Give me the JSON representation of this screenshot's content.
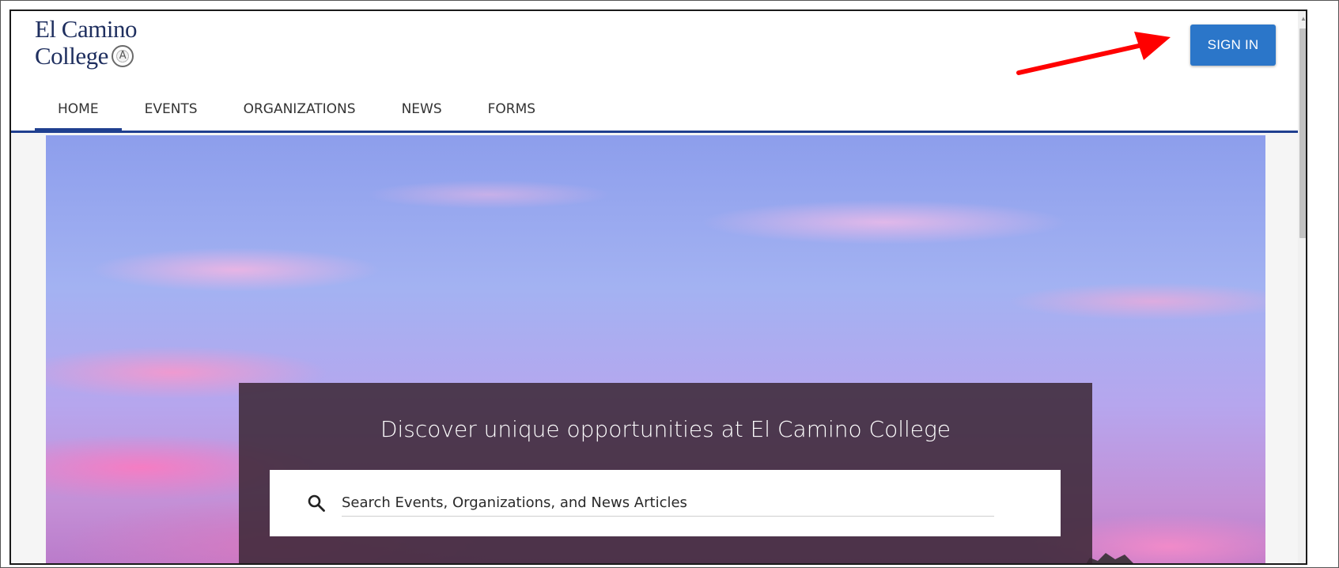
{
  "header": {
    "logo_line1": "El Camino",
    "logo_line2": "College",
    "signin_label": "SIGN IN"
  },
  "nav": {
    "items": [
      {
        "label": "HOME",
        "active": true
      },
      {
        "label": "EVENTS",
        "active": false
      },
      {
        "label": "ORGANIZATIONS",
        "active": false
      },
      {
        "label": "NEWS",
        "active": false
      },
      {
        "label": "FORMS",
        "active": false
      }
    ]
  },
  "hero": {
    "tagline": "Discover unique opportunities at El Camino College",
    "search": {
      "placeholder": "Search Events, Organizations, and News Articles",
      "value": ""
    }
  },
  "colors": {
    "brand": "#1f3f8f",
    "signin": "#2b76c9",
    "annotation_arrow": "#ff0000"
  },
  "icons": [
    "college-seal-icon",
    "search-icon",
    "annotation-arrow-icon",
    "scroll-up-arrow-icon"
  ]
}
